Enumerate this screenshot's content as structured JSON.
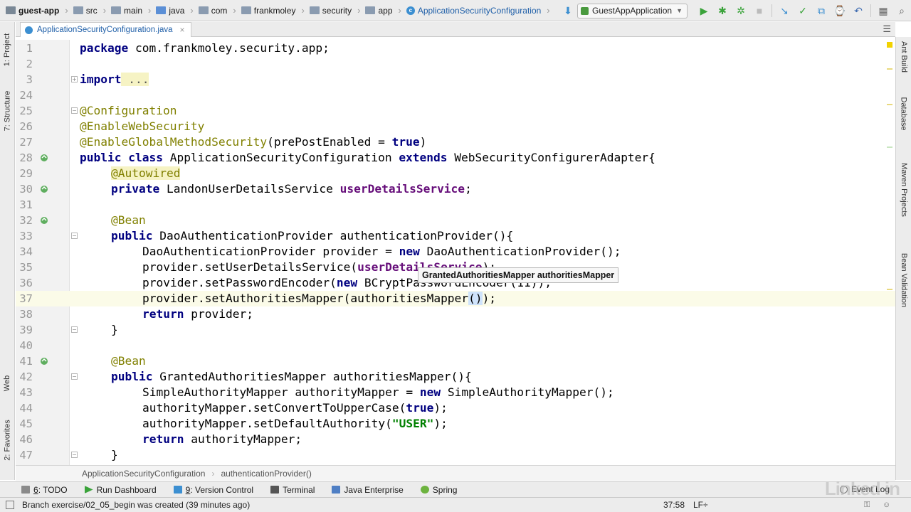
{
  "navbar": {
    "crumbs": [
      "guest-app",
      "src",
      "main",
      "java",
      "com",
      "frankmoley",
      "security",
      "app",
      "ApplicationSecurityConfiguration"
    ],
    "run_config": "GuestAppApplication"
  },
  "left_tools": {
    "project": "1: Project",
    "structure": "7: Structure",
    "web": "Web",
    "favorites": "2: Favorites"
  },
  "right_tools": {
    "ant": "Ant Build",
    "database": "Database",
    "maven": "Maven Projects",
    "bean": "Bean Validation"
  },
  "file_tab": {
    "label": "ApplicationSecurityConfiguration.java"
  },
  "editor": {
    "tooltip": "GrantedAuthoritiesMapper authoritiesMapper",
    "line_numbers": [
      "1",
      "2",
      "3",
      "24",
      "25",
      "26",
      "27",
      "28",
      "29",
      "30",
      "31",
      "32",
      "33",
      "34",
      "35",
      "36",
      "37",
      "38",
      "39",
      "40",
      "41",
      "42",
      "43",
      "44",
      "45",
      "46",
      "47"
    ],
    "code": {
      "l1_kw": "package",
      "l1_rest": " com.frankmoley.security.app;",
      "l3_kw": "import",
      "l3_rest": " ...",
      "l25": "@Configuration",
      "l26": "@EnableWebSecurity",
      "l27_ann": "@EnableGlobalMethodSecurity",
      "l27_a": "(prePostEnabled = ",
      "l27_kw": "true",
      "l27_b": ")",
      "l28_kw1": "public class",
      "l28_a": " ApplicationSecurityConfiguration ",
      "l28_kw2": "extends",
      "l28_b": " WebSecurityConfigurerAdapter{",
      "l29": "@Autowired",
      "l30_kw": "private",
      "l30_a": " LandonUserDetailsService ",
      "l30_fld": "userDetailsService",
      "l30_b": ";",
      "l32": "@Bean",
      "l33_kw": "public",
      "l33_a": " DaoAuthenticationProvider authenticationProvider(){",
      "l34_a": "DaoAuthenticationProvider provider = ",
      "l34_kw": "new",
      "l34_b": " DaoAuthenticationProvider();",
      "l35_a": "provider.setUserDetailsService(",
      "l35_fld": "userDetailsService",
      "l35_b": ");",
      "l36_a": "provider.setPasswordEncoder(",
      "l36_kw": "new",
      "l36_b": " BCryptPasswordEncoder(11));",
      "l37_a": "provider.setAuthoritiesMapper(authoritiesMapper",
      "l37_sel": "()",
      "l37_b": ");",
      "l38_kw": "return",
      "l38_a": " provider;",
      "l39": "}",
      "l41": "@Bean",
      "l42_kw": "public",
      "l42_a": " GrantedAuthoritiesMapper authoritiesMapper(){",
      "l43_a": "SimpleAuthorityMapper authorityMapper = ",
      "l43_kw": "new",
      "l43_b": " SimpleAuthorityMapper();",
      "l44_a": "authorityMapper.setConvertToUpperCase(",
      "l44_kw": "true",
      "l44_b": ");",
      "l45_a": "authorityMapper.setDefaultAuthority(",
      "l45_str": "\"USER\"",
      "l45_b": ");",
      "l46_kw": "return",
      "l46_a": " authorityMapper;",
      "l47": "}"
    }
  },
  "code_breadcrumb": [
    "ApplicationSecurityConfiguration",
    "authenticationProvider()"
  ],
  "tool_windows": {
    "todo_num": "6",
    "todo_label": ": TODO",
    "run_dashboard": "Run Dashboard",
    "vc_num": "9",
    "vc_label": ": Version Control",
    "terminal": "Terminal",
    "java_enterprise": "Java Enterprise",
    "spring": "Spring",
    "event_log": "Event Log"
  },
  "status": {
    "message": "Branch exercise/02_05_begin was created (39 minutes ago)",
    "position": "37:58",
    "line_sep": "LF÷"
  },
  "watermark": "Linked in",
  "colors": {
    "keyword": "#000080",
    "annotation": "#808000",
    "field": "#660e7a",
    "string": "#008000"
  }
}
